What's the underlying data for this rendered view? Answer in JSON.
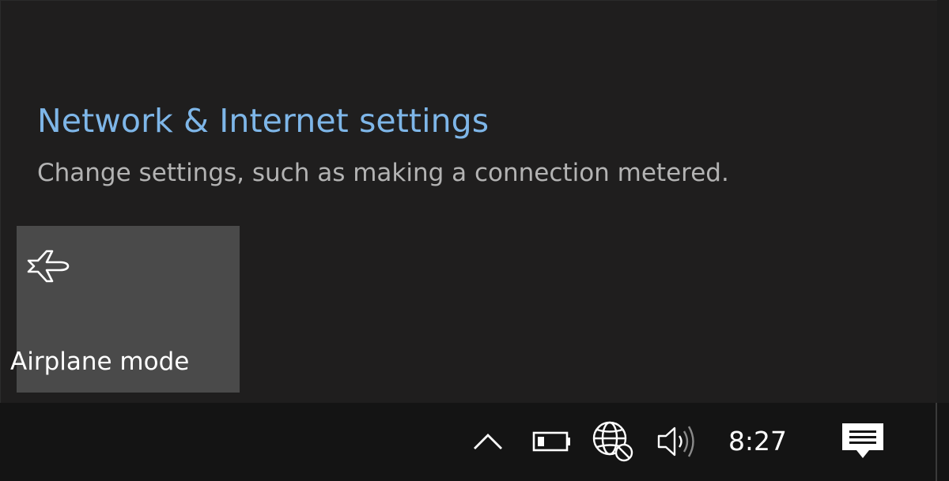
{
  "flyout": {
    "settings_link": "Network & Internet settings",
    "settings_description": "Change settings, such as making a connection metered."
  },
  "quick_actions": [
    {
      "label": "Airplane mode",
      "icon": "airplane-icon",
      "state": "off"
    }
  ],
  "taskbar": {
    "tray_icons": [
      "chevron-up-icon",
      "battery-icon",
      "network-globe-icon",
      "volume-icon",
      "action-center-icon"
    ],
    "clock": "8:27"
  },
  "colors": {
    "link": "#7eb6e8",
    "flyout_bg": "#1f1e1e",
    "tile_bg": "#4a4a4a",
    "taskbar_bg": "#141414"
  }
}
